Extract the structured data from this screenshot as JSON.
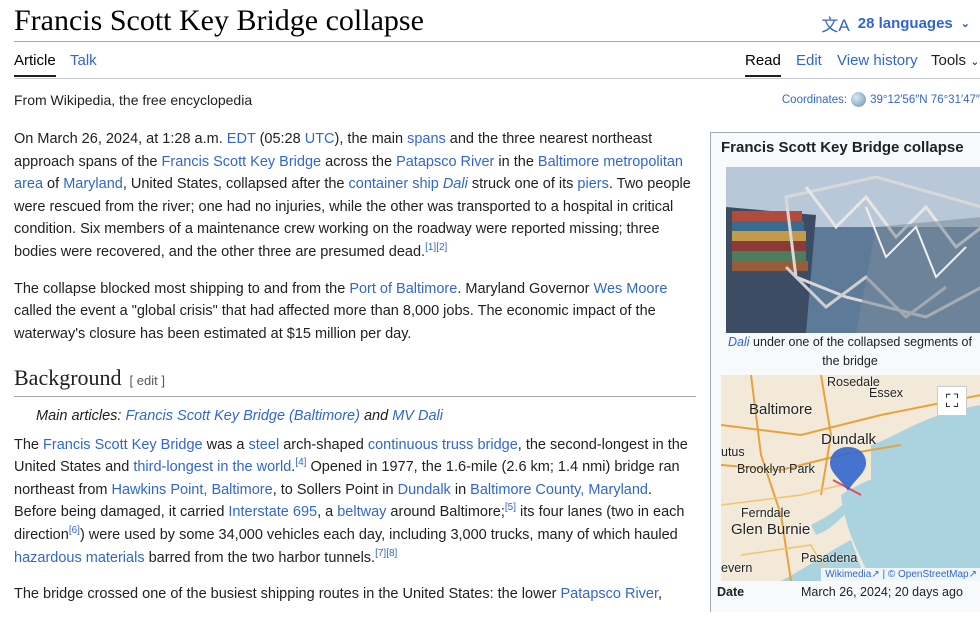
{
  "header": {
    "title": "Francis Scott Key Bridge collapse",
    "languages": "28 languages"
  },
  "tabs": {
    "article": "Article",
    "talk": "Talk",
    "read": "Read",
    "edit": "Edit",
    "history": "View history",
    "tools": "Tools"
  },
  "tagline": "From Wikipedia, the free encyclopedia",
  "coordinates": {
    "label": "Coordinates:",
    "value": "39°12′56″N 76°31′47″"
  },
  "para1": {
    "t1": "On March 26, 2024, at 1:28 a.m. ",
    "l_edt": "EDT",
    "t2": " (05:28 ",
    "l_utc": "UTC",
    "t3": "), the main ",
    "l_spans": "spans",
    "t4": " and the three nearest northeast approach spans of the ",
    "l_fskb": "Francis Scott Key Bridge",
    "t5": " across the ",
    "l_patapsco": "Patapsco River",
    "t6": " in the ",
    "l_metro": "Baltimore metropolitan area",
    "t7": " of ",
    "l_maryland": "Maryland",
    "t8": ", United States, collapsed after the ",
    "l_ship": "container ship",
    "t9": " ",
    "l_dali": "Dali",
    "t10": " struck one of its ",
    "l_piers": "piers",
    "t11": ". Two people were rescued from the river; one had no injuries, while the other was transported to a hospital in critical condition. Six members of a maintenance crew working on the roadway were reported missing; three bodies were recovered, and the other three are presumed dead.",
    "ref": "[1][2]"
  },
  "para2": {
    "t1": "The collapse blocked most shipping to and from the ",
    "l_port": "Port of Baltimore",
    "t2": ". Maryland Governor ",
    "l_moore": "Wes Moore",
    "t3": " called the event a \"global crisis\" that had affected more than 8,000 jobs. The economic impact of the waterway's closure has been estimated at $15 million per day."
  },
  "background": {
    "heading": "Background",
    "edit": "[ edit ]",
    "hat_prefix": "Main articles: ",
    "hat_l1": "Francis Scott Key Bridge (Baltimore)",
    "hat_and": " and ",
    "hat_l2": "MV Dali"
  },
  "para3": {
    "t1": "The ",
    "l_fskb": "Francis Scott Key Bridge",
    "t2": " was a ",
    "l_steel": "steel",
    "t3": " arch-shaped ",
    "l_truss": "continuous truss bridge",
    "t4": ", the second-longest in the United States and ",
    "l_third": "third-longest in the world",
    "t5": ".",
    "ref4": "[4]",
    "t6": " Opened in 1977, the 1.6-mile (2.6 km; 1.4 nmi) bridge ran northeast from ",
    "l_hawkins": "Hawkins Point, Baltimore",
    "t7": ", to Sollers Point in ",
    "l_dundalk": "Dundalk",
    "t8": " in ",
    "l_county": "Baltimore County, Maryland",
    "t9": ". Before being damaged, it carried ",
    "l_i695": "Interstate 695",
    "t10": ", a ",
    "l_beltway": "beltway",
    "t11": " around Baltimore;",
    "ref5": "[5]",
    "t12": " its four lanes (two in each direction",
    "ref6": "[6]",
    "t13": ") were used by some 34,000 vehicles each day, including 3,000 trucks, many of which hauled ",
    "l_hazmat": "hazardous materials",
    "t14": " barred from the two harbor tunnels.",
    "ref78": "[7][8]"
  },
  "para4": {
    "t1": "The bridge crossed one of the busiest shipping routes in the United States: the lower ",
    "l_patapsco": "Patapsco River",
    "t2": ","
  },
  "infobox": {
    "title": "Francis Scott Key Bridge collapse",
    "caption_link": "Dali",
    "caption_text": " under one of the collapsed segments of the bridge",
    "map_labels": {
      "rosedale": "Rosedale",
      "essex": "Essex",
      "baltimore": "Baltimore",
      "dundalk": "Dundalk",
      "utus": "utus",
      "brooklyn": "Brooklyn Park",
      "ferndale": "Ferndale",
      "glen": "Glen Burnie",
      "pasadena": "Pasadena",
      "severn": "evern"
    },
    "map_attrib": "Wikimedia↗ | © OpenStreetMap↗",
    "row_key": "Date",
    "row_value": "March 26, 2024; 20 days ago"
  },
  "colors": {
    "link": "#3366cc",
    "text": "#202122",
    "marker": "#3366cc"
  }
}
